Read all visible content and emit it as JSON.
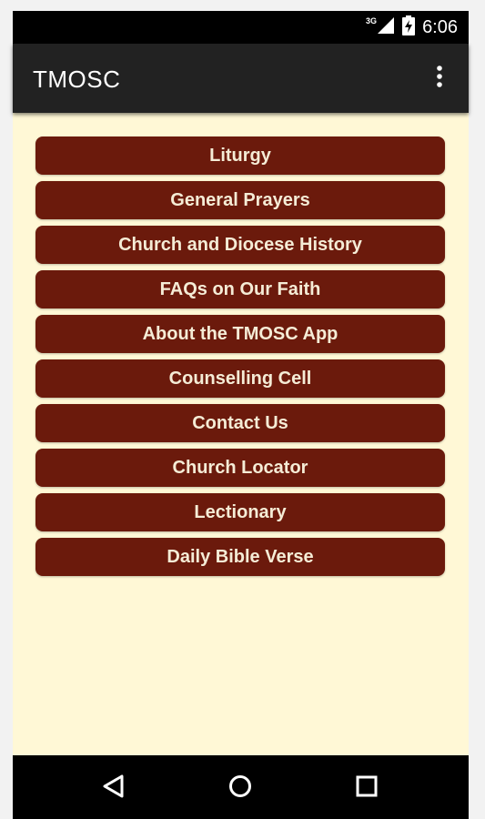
{
  "status_bar": {
    "network_type": "3G",
    "time": "6:06",
    "icons": [
      "signal-icon",
      "battery-charging-icon"
    ]
  },
  "app_bar": {
    "title": "TMOSC",
    "overflow_icon": "more-vert-icon"
  },
  "menu": {
    "items": [
      {
        "label": "Liturgy"
      },
      {
        "label": "General Prayers"
      },
      {
        "label": "Church and Diocese History"
      },
      {
        "label": "FAQs on Our Faith"
      },
      {
        "label": "About the TMOSC App"
      },
      {
        "label": "Counselling Cell"
      },
      {
        "label": "Contact Us"
      },
      {
        "label": "Church Locator"
      },
      {
        "label": "Lectionary"
      },
      {
        "label": "Daily Bible Verse"
      }
    ]
  },
  "nav_bar": {
    "icons": [
      "back-icon",
      "home-icon",
      "recents-icon"
    ]
  },
  "colors": {
    "button_bg": "#6b1a0c",
    "button_text": "#f5ecd6",
    "content_bg": "#fff8d6",
    "app_bar_bg": "#222222"
  }
}
